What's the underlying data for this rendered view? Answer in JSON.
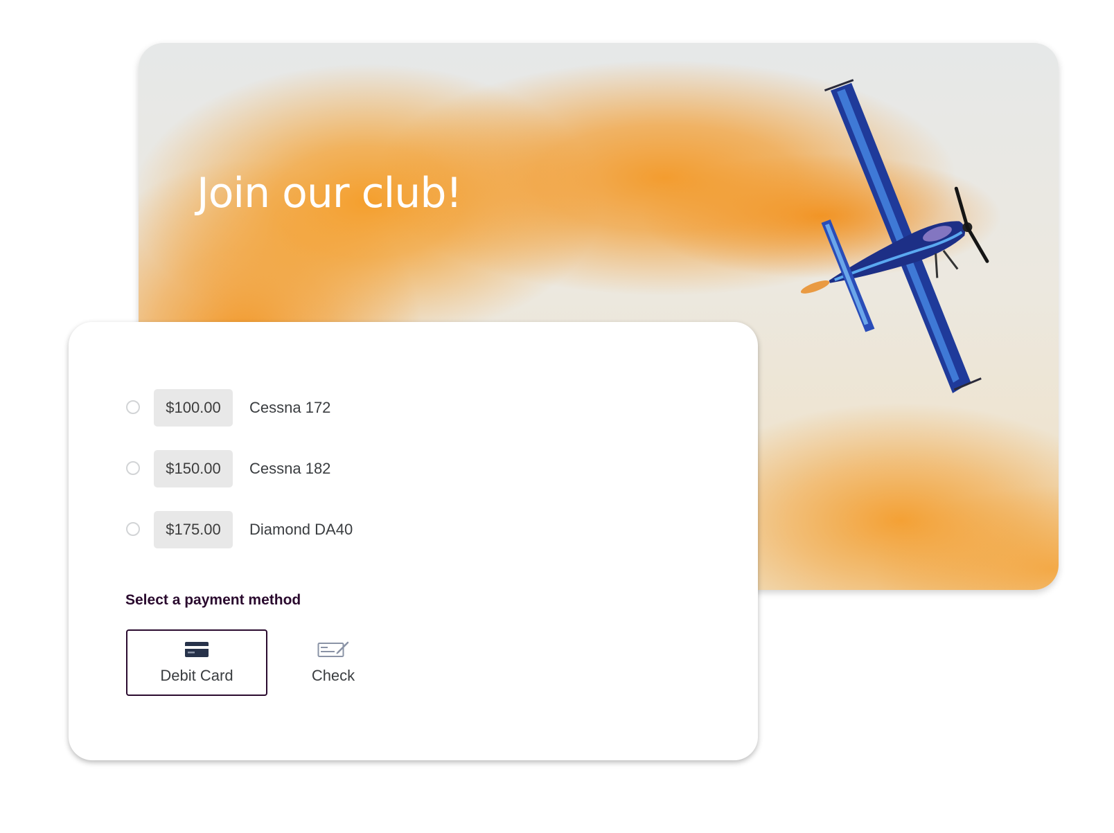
{
  "hero": {
    "title": "Join our club!"
  },
  "plans": [
    {
      "price": "$100.00",
      "aircraft": "Cessna 172"
    },
    {
      "price": "$150.00",
      "aircraft": "Cessna 182"
    },
    {
      "price": "$175.00",
      "aircraft": "Diamond DA40"
    }
  ],
  "payment": {
    "heading": "Select a payment method",
    "options": [
      {
        "label": "Debit Card",
        "icon": "debit-card-icon",
        "selected": true
      },
      {
        "label": "Check",
        "icon": "check-icon",
        "selected": false
      }
    ]
  },
  "colors": {
    "accent": "#2a0a2e",
    "smoke": "#f39a20",
    "plane": "#1e3f9e",
    "price_bg": "#e8e8e8"
  }
}
